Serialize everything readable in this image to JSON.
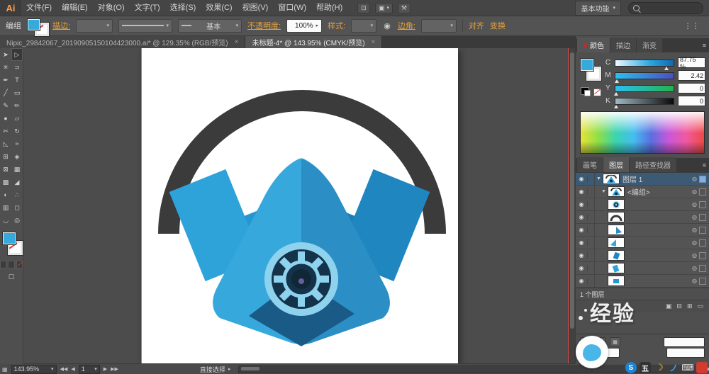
{
  "colors": {
    "accent_cyan": "#35aadc",
    "ui_background": "#4f4f4f",
    "canvas_background": "#4c4c4c",
    "link_orange": "#e8a23c",
    "selected_layer_blue": "#3d5a75",
    "mask_light_blue": "#37a8dc",
    "mask_dark_blue": "#2b8fc6",
    "headband_gray": "#3b3b3b"
  },
  "menubar": {
    "logo": "Ai",
    "items": [
      "文件(F)",
      "编辑(E)",
      "对象(O)",
      "文字(T)",
      "选择(S)",
      "效果(C)",
      "视图(V)",
      "窗口(W)",
      "帮助(H)"
    ],
    "workspace": "基本功能"
  },
  "controlbar": {
    "context_label": "编组",
    "stroke_label": "描边:",
    "brush_definition": "基本",
    "opacity_label": "不透明度:",
    "opacity_value": "100%",
    "style_label": "样式:",
    "corner_label": "边角:",
    "align_label": "对齐",
    "transform_label": "变换"
  },
  "document_tabs": [
    {
      "title": "Nipic_29842067_20190905150104423000.ai* @ 129.35% (RGB/预览)",
      "close": "×"
    },
    {
      "title": "未标题-4* @ 143.95% (CMYK/预览)",
      "close": "×"
    }
  ],
  "color_panel": {
    "tabs": [
      "颜色",
      "描边",
      "渐变"
    ],
    "channels": [
      {
        "label": "C",
        "value": "87.75 %"
      },
      {
        "label": "M",
        "value": "2.42"
      },
      {
        "label": "Y",
        "value": "0"
      },
      {
        "label": "K",
        "value": "0"
      }
    ]
  },
  "dock_tabs": [
    "画笔",
    "图层",
    "路径查找器"
  ],
  "layers_panel": {
    "rows": [
      {
        "name": "图层 1"
      },
      {
        "name": "<编组>"
      },
      {
        "name": ""
      },
      {
        "name": ""
      },
      {
        "name": ""
      },
      {
        "name": ""
      },
      {
        "name": ""
      },
      {
        "name": ""
      },
      {
        "name": ""
      }
    ],
    "footer": "1 个图层"
  },
  "statusbar": {
    "zoom": "143.95%",
    "artboard_nav": "1",
    "tool": "直接选择"
  },
  "watermark": {
    "text": "经验"
  },
  "taskbar_icons": [
    "S",
    "五",
    "☽",
    "ノ",
    "⌨",
    ""
  ]
}
